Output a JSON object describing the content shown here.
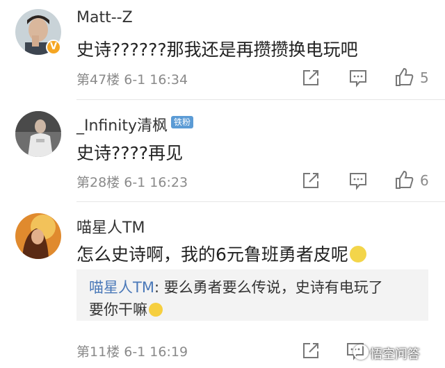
{
  "comments": [
    {
      "username": "Matt--Z",
      "verified": true,
      "content": "史诗??????那我还是再攒攒换电玩吧",
      "floor": "第47楼",
      "date": "6-1 16:34",
      "likes": "5"
    },
    {
      "username": "_Infinity清枫",
      "badge": "铁粉",
      "content": "史诗????再见",
      "floor": "第28楼",
      "date": "6-1 16:23",
      "likes": "6"
    },
    {
      "username": "喵星人TM",
      "content": "怎么史诗啊，我的6元鲁班勇者皮呢",
      "reply": {
        "user": "喵星人TM",
        "line1": ": 要么勇者要么传说，史诗有电玩了",
        "line2": "要你干嘛"
      },
      "floor": "第11楼",
      "date": "6-1 16:19"
    }
  ],
  "watermark": "悟空问答",
  "icons": {
    "share": "share-icon",
    "comment": "comment-icon",
    "like": "thumbs-up-icon"
  }
}
